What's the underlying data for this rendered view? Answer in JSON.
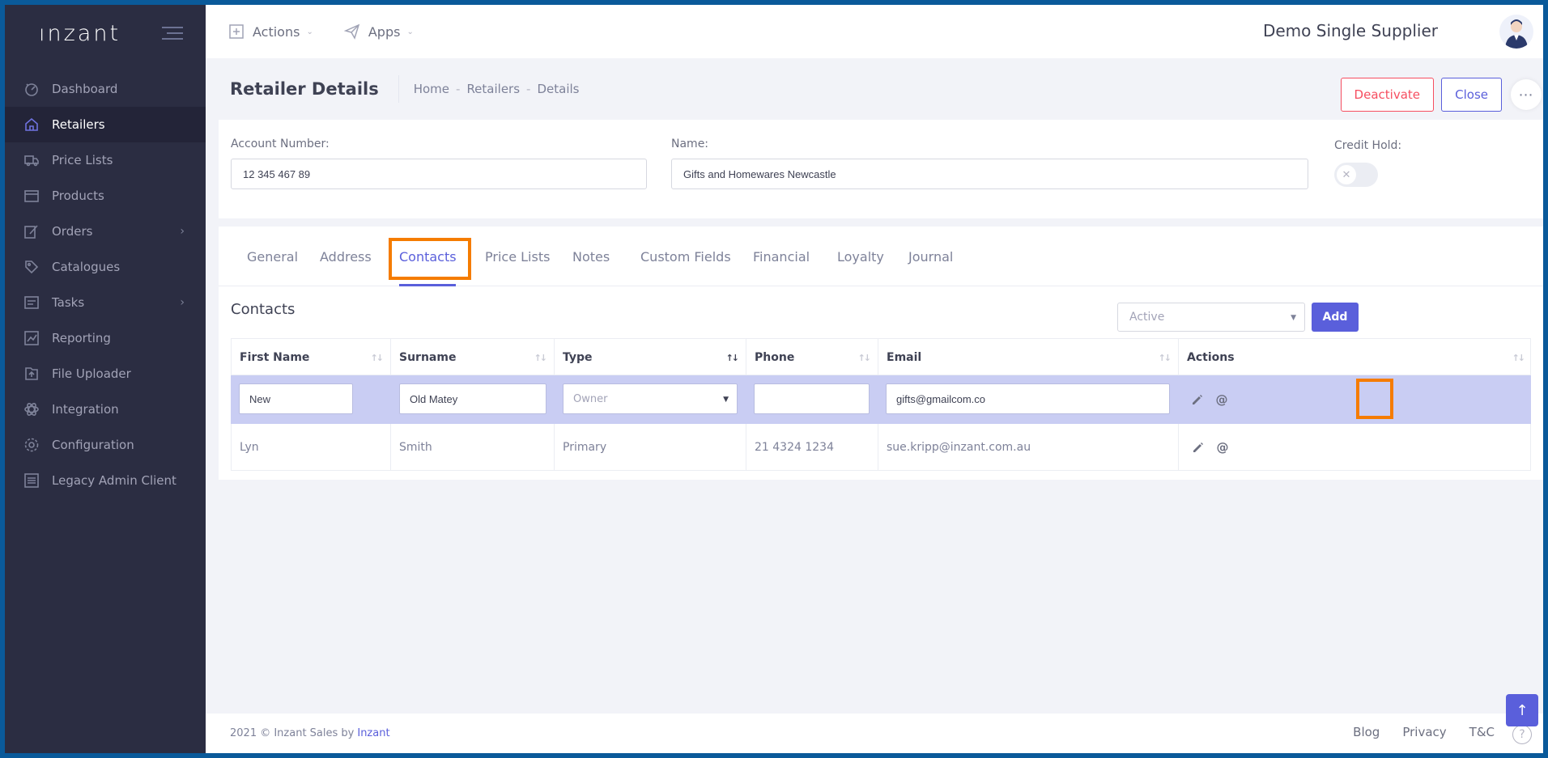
{
  "brand": {
    "logo_text": "ınzant"
  },
  "sidebar": {
    "items": [
      {
        "label": "Dashboard"
      },
      {
        "label": "Retailers"
      },
      {
        "label": "Price Lists"
      },
      {
        "label": "Products"
      },
      {
        "label": "Orders"
      },
      {
        "label": "Catalogues"
      },
      {
        "label": "Tasks"
      },
      {
        "label": "Reporting"
      },
      {
        "label": "File Uploader"
      },
      {
        "label": "Integration"
      },
      {
        "label": "Configuration"
      },
      {
        "label": "Legacy Admin Client"
      }
    ],
    "active_index": 1
  },
  "topbar": {
    "actions_label": "Actions",
    "apps_label": "Apps",
    "supplier": "Demo Single Supplier"
  },
  "subheader": {
    "title": "Retailer Details",
    "breadcrumb": [
      "Home",
      "Retailers",
      "Details"
    ],
    "deactivate_label": "Deactivate",
    "close_label": "Close",
    "more_label": "⋯"
  },
  "details": {
    "account_label": "Account Number:",
    "account_value": "12 345 467 89",
    "name_label": "Name:",
    "name_value": "Gifts and Homewares Newcastle",
    "credit_hold_label": "Credit Hold:",
    "credit_hold": false
  },
  "tabs": [
    {
      "label": "General"
    },
    {
      "label": "Address"
    },
    {
      "label": "Contacts"
    },
    {
      "label": "Price Lists"
    },
    {
      "label": "Notes"
    },
    {
      "label": "Custom Fields"
    },
    {
      "label": "Financial"
    },
    {
      "label": "Loyalty"
    },
    {
      "label": "Journal"
    }
  ],
  "contacts": {
    "title": "Contacts",
    "status_filter": "Active",
    "add_label": "Add",
    "columns": [
      "First Name",
      "Surname",
      "Type",
      "Phone",
      "Email",
      "Actions"
    ],
    "edit_row": {
      "first_name": "New",
      "surname": "Old Matey",
      "type_placeholder": "Owner",
      "phone": "",
      "email": "gifts@gmailcom.co"
    },
    "rows": [
      {
        "first_name": "Lyn",
        "surname": "Smith",
        "type": "Primary",
        "phone": "21 4324 1234",
        "email": "sue.kripp@inzant.com.au"
      }
    ],
    "email_action_symbol": "@"
  },
  "footer": {
    "copyright": "2021 © Inzant Sales by",
    "brand_link": "Inzant",
    "links": [
      "Blog",
      "Privacy",
      "T&C"
    ],
    "help_symbol": "?"
  },
  "colors": {
    "accent": "#5a5fdb",
    "sidebar_bg": "#2b2d42",
    "danger": "#f64e60",
    "highlight": "#f57c00"
  }
}
